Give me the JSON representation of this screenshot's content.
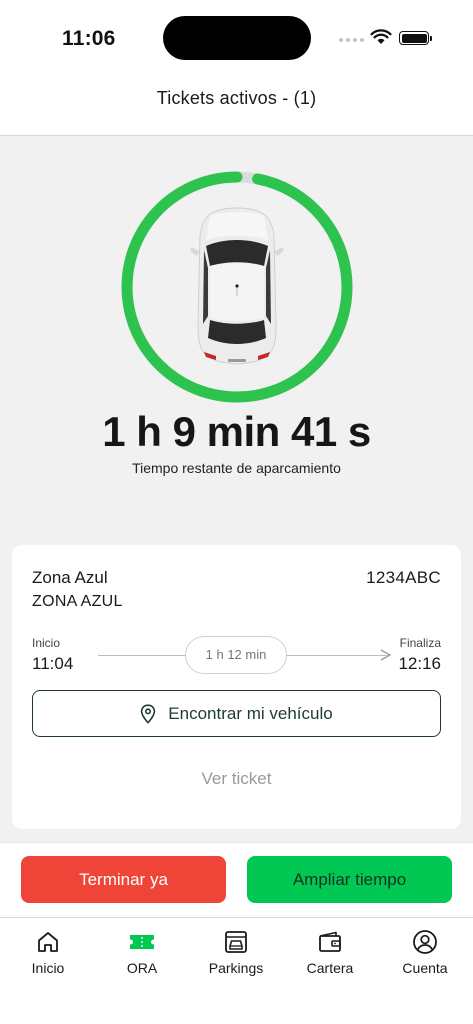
{
  "status_bar": {
    "time": "11:06",
    "icons": [
      "cellular-dots-icon",
      "wifi-icon",
      "battery-icon"
    ]
  },
  "header": {
    "title": "Tickets activos - (1)"
  },
  "timer": {
    "remaining": "1 h 9 min 41 s",
    "caption": "Tiempo restante de aparcamiento",
    "progress_remaining_fraction": 0.97,
    "ring_color": "#2ec24e"
  },
  "ticket": {
    "zone_name": "Zona Azul",
    "zone_code": "ZONA AZUL",
    "plate": "1234ABC",
    "start_label": "Inicio",
    "start_time": "11:04",
    "end_label": "Finaliza",
    "end_time": "12:16",
    "duration": "1 h 12 min",
    "find_vehicle_label": "Encontrar mi vehículo",
    "view_ticket_label": "Ver ticket"
  },
  "actions": {
    "end_now_label": "Terminar ya",
    "extend_label": "Ampliar tiempo",
    "end_color": "#ef4538",
    "extend_color": "#00c853"
  },
  "tabbar": {
    "active_color": "#00c853",
    "items": [
      {
        "label": "Inicio",
        "icon": "home-icon",
        "active": false
      },
      {
        "label": "ORA",
        "icon": "ticket-icon",
        "active": true
      },
      {
        "label": "Parkings",
        "icon": "parking-garage-icon",
        "active": false
      },
      {
        "label": "Cartera",
        "icon": "wallet-icon",
        "active": false
      },
      {
        "label": "Cuenta",
        "icon": "account-icon",
        "active": false
      }
    ]
  }
}
